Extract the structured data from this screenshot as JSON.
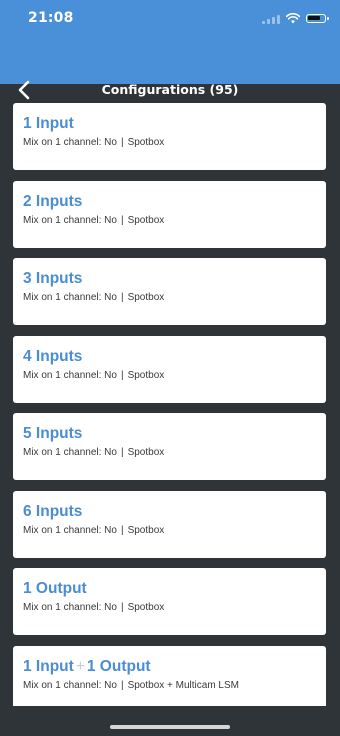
{
  "status_bar": {
    "time": "21:08",
    "signal_icon": "signal-bars-icon",
    "wifi_icon": "wifi-icon",
    "battery_icon": "battery-icon"
  },
  "nav": {
    "back_icon": "chevron-left-icon",
    "title": "Configurations (95)"
  },
  "colors": {
    "header": "#4a90d9",
    "background": "#2f3439",
    "card": "#ffffff",
    "title_text": "#4a8ed1"
  },
  "items": [
    {
      "title": "1 Input",
      "mix": "Mix on 1 channel: No",
      "sep": "|",
      "device": "Spotbox"
    },
    {
      "title": "2 Inputs",
      "mix": "Mix on 1 channel: No",
      "sep": "|",
      "device": "Spotbox"
    },
    {
      "title": "3 Inputs",
      "mix": "Mix on 1 channel: No",
      "sep": "|",
      "device": "Spotbox"
    },
    {
      "title": "4 Inputs",
      "mix": "Mix on 1 channel: No",
      "sep": "|",
      "device": "Spotbox"
    },
    {
      "title": "5 Inputs",
      "mix": "Mix on 1 channel: No",
      "sep": "|",
      "device": "Spotbox"
    },
    {
      "title": "6 Inputs",
      "mix": "Mix on 1 channel: No",
      "sep": "|",
      "device": "Spotbox"
    },
    {
      "title": "1 Output",
      "mix": "Mix on 1 channel: No",
      "sep": "|",
      "device": "Spotbox"
    },
    {
      "title_a": "1 Input",
      "plus": "+",
      "title_b": "1 Output",
      "mix": "Mix on 1 channel: No",
      "sep": "|",
      "device": "Spotbox + Multicam LSM"
    }
  ]
}
